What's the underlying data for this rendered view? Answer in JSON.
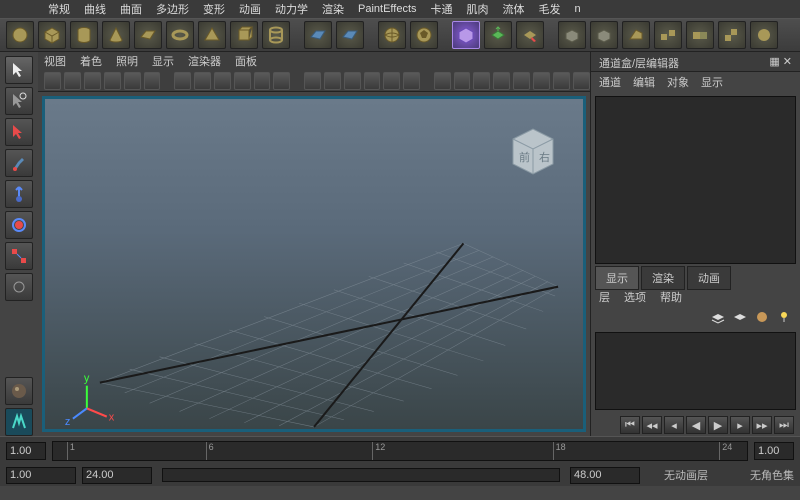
{
  "menubar": [
    "常规",
    "曲线",
    "曲面",
    "多边形",
    "变形",
    "动画",
    "动力学",
    "渲染",
    "PaintEffects",
    "卡通",
    "肌肉",
    "流体",
    "毛发",
    "n"
  ],
  "viewmenu": [
    "视图",
    "着色",
    "照明",
    "显示",
    "渲染器",
    "面板"
  ],
  "channel": {
    "title": "通道盒/层编辑器",
    "tabs": [
      "通道",
      "编辑",
      "对象",
      "显示"
    ]
  },
  "layertabs": [
    "显示",
    "渲染",
    "动画"
  ],
  "layersub": [
    "层",
    "选项",
    "帮助"
  ],
  "tl": {
    "start": "1.00",
    "f1": "1",
    "f6": "6",
    "f12": "12",
    "f18": "18",
    "f24": "24",
    "end": "1.00",
    "low": "1.00",
    "high": "24.00",
    "range": "48.00"
  },
  "status": {
    "animlayer": "无动画层",
    "charset": "无角色集"
  },
  "viewcube": {
    "front": "前",
    "right": "右"
  }
}
